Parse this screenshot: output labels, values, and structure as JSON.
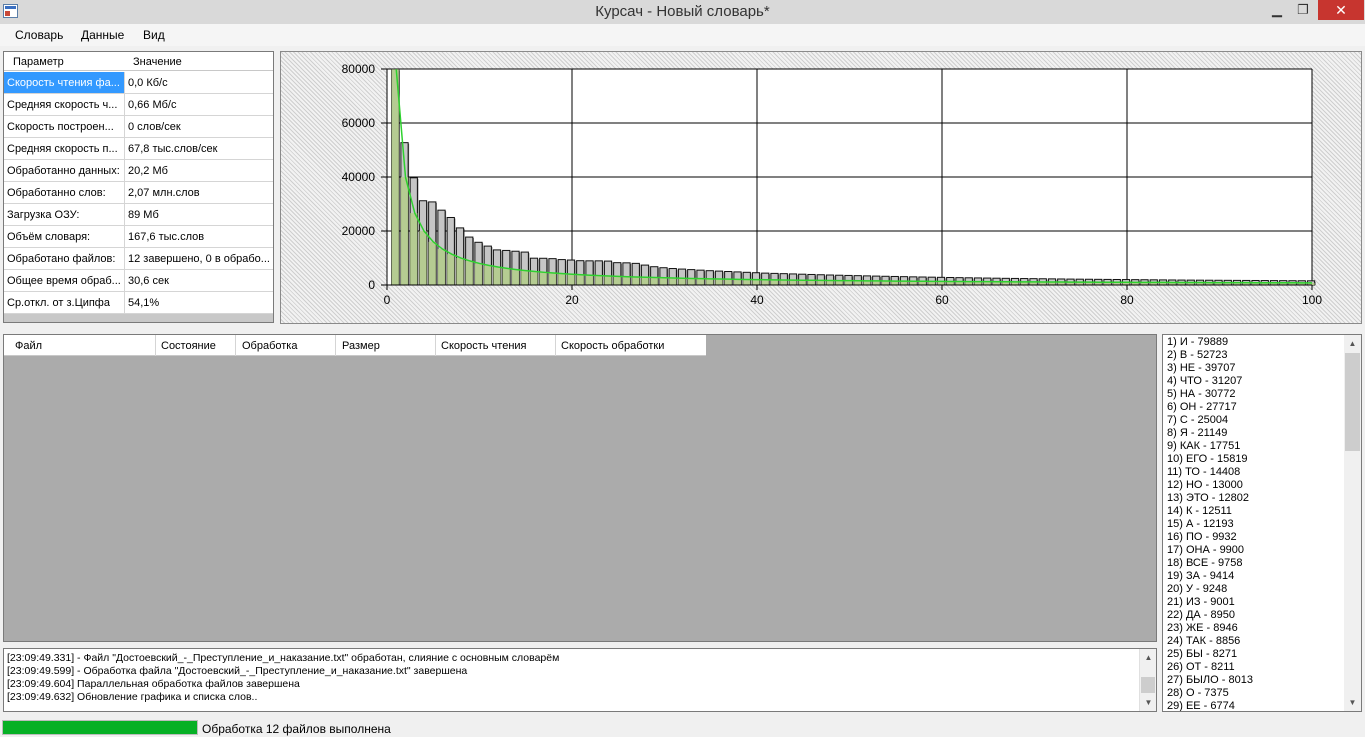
{
  "window": {
    "title": "Курсач - Новый словарь*",
    "min_glyph": "▁",
    "max_glyph": "❐",
    "close_glyph": "✕"
  },
  "menu": [
    "Словарь",
    "Данные",
    "Вид"
  ],
  "params": {
    "col_param": "Параметр",
    "col_value": "Значение",
    "rows": [
      {
        "name": "Скорость чтения фа...",
        "value": "0,0 Кб/с"
      },
      {
        "name": "Средняя скорость ч...",
        "value": "0,66 Мб/с"
      },
      {
        "name": "Скорость построен...",
        "value": "0 слов/сек"
      },
      {
        "name": "Средняя скорость п...",
        "value": "67,8 тыс.слов/сек"
      },
      {
        "name": "Обработанно данных:",
        "value": "20,2 Мб"
      },
      {
        "name": "Обработанно слов:",
        "value": "2,07 млн.слов"
      },
      {
        "name": "Загрузка ОЗУ:",
        "value": "89 Мб"
      },
      {
        "name": "Объём словаря:",
        "value": "167,6 тыс.слов"
      },
      {
        "name": "Обработано файлов:",
        "value": "12 завершено, 0 в обрабо..."
      },
      {
        "name": "Общее время обраб...",
        "value": "30,6 сек"
      },
      {
        "name": "Ср.откл. от з.Ципфа",
        "value": "54,1%"
      }
    ]
  },
  "chart_data": {
    "type": "bar",
    "title": "",
    "xlabel": "",
    "ylabel": "",
    "xlim": [
      0,
      100
    ],
    "ylim": [
      0,
      80000
    ],
    "x_ticks": [
      0,
      20,
      40,
      60,
      80,
      100
    ],
    "y_ticks": [
      0,
      20000,
      40000,
      60000,
      80000
    ],
    "grid": true,
    "colors": {
      "bar_fill": "#c6c6c6",
      "bar_stroke": "#111111",
      "zipf_fill": "#b3cc8c",
      "zipf_line": "#2ed12e"
    },
    "series": [
      {
        "values": [
          79889,
          52723,
          39707,
          31207,
          30772,
          27717,
          25004,
          21149,
          17751,
          15819,
          14408,
          13000,
          12802,
          12511,
          12193,
          9932,
          9900,
          9758,
          9414,
          9248,
          9001,
          8950,
          8946,
          8856,
          8271,
          8211,
          8013,
          7375,
          6774,
          6400,
          6100,
          5900,
          5700,
          5500,
          5300,
          5150,
          5000,
          4850,
          4700,
          4550,
          4400,
          4300,
          4200,
          4100,
          4000,
          3900,
          3800,
          3700,
          3620,
          3540,
          3460,
          3380,
          3300,
          3230,
          3160,
          3090,
          3020,
          2960,
          2900,
          2840,
          2780,
          2720,
          2670,
          2620,
          2570,
          2520,
          2470,
          2430,
          2390,
          2350,
          2310,
          2270,
          2230,
          2190,
          2160,
          2130,
          2100,
          2070,
          2040,
          2010,
          1980,
          1950,
          1920,
          1890,
          1860,
          1830,
          1810,
          1790,
          1770,
          1750,
          1730,
          1710,
          1690,
          1670,
          1650,
          1630,
          1610,
          1590,
          1570,
          1550
        ]
      },
      {
        "values": [
          79889,
          39945,
          26630,
          19972,
          15978,
          13315,
          11413,
          9986,
          8877,
          7989,
          7263,
          6657,
          6145,
          5706,
          5326,
          4993,
          4699,
          4438,
          4205,
          3994,
          3804,
          3631,
          3473,
          3329,
          3196,
          3073,
          2959,
          2853,
          2755,
          2663,
          2577,
          2497,
          2421,
          2350,
          2283,
          2219,
          2159,
          2102,
          2048,
          1997,
          1949,
          1902,
          1858,
          1816,
          1775,
          1737,
          1700,
          1664,
          1630,
          1598,
          1566,
          1536,
          1507,
          1479,
          1453,
          1427,
          1402,
          1377,
          1354,
          1331,
          1310,
          1289,
          1268,
          1248,
          1229,
          1210,
          1192,
          1175,
          1158,
          1141,
          1125,
          1110,
          1094,
          1080,
          1065,
          1051,
          1038,
          1024,
          1011,
          999,
          986,
          974,
          963,
          951,
          940,
          929,
          918,
          908,
          898,
          888,
          878,
          868,
          859,
          850,
          841,
          832,
          824,
          815,
          807,
          799
        ]
      }
    ]
  },
  "files": {
    "columns": [
      "Файл",
      "Состояние",
      "Обработка",
      "Размер",
      "Скорость чтения",
      "Скорость обработки"
    ]
  },
  "log": {
    "lines": [
      "[23:09:49.331] - Файл \"Достоевский_-_Преступление_и_наказание.txt\" обработан, слияние с основным словарём",
      "[23:09:49.599] - Обработка файла \"Достоевский_-_Преступление_и_наказание.txt\" завершена",
      "[23:09:49.604] Параллельная обработка файлов завершена",
      "[23:09:49.632] Обновление графика и списка слов.."
    ]
  },
  "words": [
    "1) И - 79889",
    "2) В - 52723",
    "3) НЕ - 39707",
    "4) ЧТО - 31207",
    "5) НА - 30772",
    "6) ОН - 27717",
    "7) С - 25004",
    "8) Я - 21149",
    "9) КАК - 17751",
    "10) ЕГО - 15819",
    "11) ТО - 14408",
    "12) НО - 13000",
    "13) ЭТО - 12802",
    "14) К - 12511",
    "15) А - 12193",
    "16) ПО - 9932",
    "17) ОНА - 9900",
    "18) ВСЕ - 9758",
    "19) ЗА - 9414",
    "20) У - 9248",
    "21) ИЗ - 9001",
    "22) ДА - 8950",
    "23) ЖЕ - 8946",
    "24) ТАК - 8856",
    "25) БЫ - 8271",
    "26) ОТ - 8211",
    "27) БЫЛО - 8013",
    "28) О - 7375",
    "29) ЕЕ - 6774"
  ],
  "status": {
    "progress": 1.0,
    "text": "Обработка 12 файлов выполнена"
  }
}
